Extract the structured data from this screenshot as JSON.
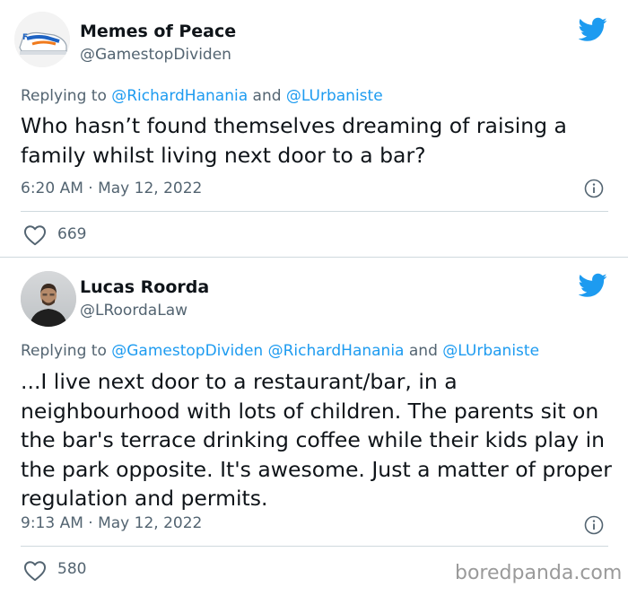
{
  "tweets": [
    {
      "author_name": "Memes of Peace",
      "author_handle": "@GamestopDividen",
      "replying_prefix": "Replying to ",
      "mentions": [
        "@RichardHanania",
        "@LUrbaniste"
      ],
      "and_word": " and ",
      "text": "Who hasn’t found themselves dreaming of raising a family whilst living next door to a bar?",
      "timestamp": "6:20 AM · May 12, 2022",
      "likes": "669",
      "avatar_icon": "sneaker-avatar-icon"
    },
    {
      "author_name": "Lucas Roorda",
      "author_handle": "@LRoordaLaw",
      "replying_prefix": "Replying to ",
      "mentions": [
        "@GamestopDividen",
        "@RichardHanania",
        "@LUrbaniste"
      ],
      "and_word": " and ",
      "text": "...I live next door to a restaurant/bar, in a neighbourhood with lots of children. The parents sit on the bar's terrace drinking coffee while their kids play in the park opposite. It's awesome. Just a matter of proper regulation and permits.",
      "timestamp": "9:13 AM · May 12, 2022",
      "likes": "580",
      "avatar_icon": "person-photo-avatar-icon"
    }
  ],
  "watermark": "boredpanda.com",
  "colors": {
    "twitter_blue": "#1d9bf0",
    "secondary_text": "#536471",
    "primary_text": "#0f1419",
    "divider": "#cfd9de"
  }
}
